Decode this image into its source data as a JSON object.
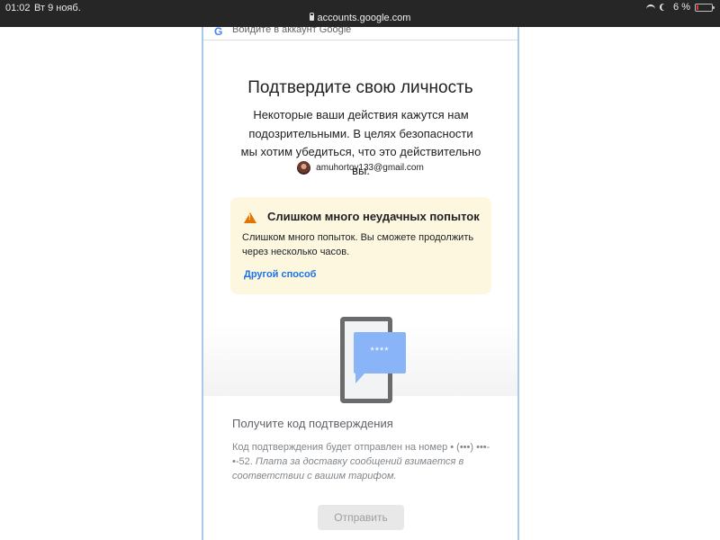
{
  "statusbar": {
    "time": "01:02",
    "date": "Вт 9 нояб.",
    "url": "accounts.google.com",
    "battery": "6 %"
  },
  "header": {
    "logo_letter": "G",
    "signin_text": "Войдите в аккаунт Google"
  },
  "main": {
    "title": "Подтвердите свою личность",
    "description": "Некоторые ваши действия кажутся нам подозрительными. В целях безопасности мы хотим убедиться, что это действительно вы.",
    "account_email": "amuhortov133@gmail.com"
  },
  "alert": {
    "title": "Слишком много неудачных попыток",
    "text": "Слишком много попыток. Вы сможете продолжить через несколько часов.",
    "link": "Другой способ"
  },
  "illustration": {
    "stars": "****"
  },
  "code": {
    "title": "Получите код подтверждения",
    "description_prefix": "Код подтверждения будет отправлен на номер • (•••) •••-•-52. ",
    "description_italic": "Плата за доставку сообщений взимается в соответствии с вашим тарифом.",
    "send_button": "Отправить"
  },
  "colors": {
    "statusbar_bg": "#262626",
    "frame_border": "#a9c9ec",
    "alert_bg": "#fef7e0",
    "warning": "#e37400",
    "link": "#1a73e8",
    "bubble": "#8ab4f8"
  }
}
